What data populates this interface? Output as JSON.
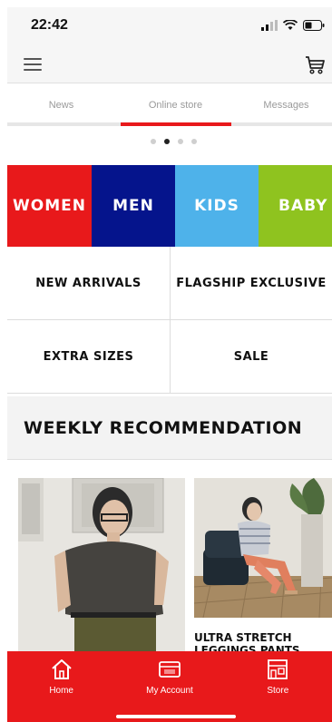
{
  "status": {
    "time": "22:42"
  },
  "tabs": [
    {
      "label": "News"
    },
    {
      "label": "Online store"
    },
    {
      "label": "Messages"
    }
  ],
  "categories": [
    {
      "label": "WOMEN",
      "color": "#e8191b"
    },
    {
      "label": "MEN",
      "color": "#05148c"
    },
    {
      "label": "KIDS",
      "color": "#4eb2ea"
    },
    {
      "label": "BABY",
      "color": "#8fc31f"
    }
  ],
  "grid": {
    "new_arrivals": "NEW ARRIVALS",
    "flagship_exclusive": "FLAGSHIP EXCLUSIVE",
    "extra_sizes": "EXTRA SIZES",
    "sale": "SALE"
  },
  "weekly": {
    "title": "WEEKLY RECOMMENDATION",
    "item2_title": "ULTRA STRETCH LEGGINGS PANTS"
  },
  "bottom_nav": {
    "home": "Home",
    "account": "My Account",
    "store": "Store"
  },
  "colors": {
    "accent": "#e8191b",
    "tab_text": "#9a9a9a"
  },
  "icons": [
    "menu-icon",
    "cart-icon",
    "home-icon",
    "account-card-icon",
    "store-icon"
  ]
}
